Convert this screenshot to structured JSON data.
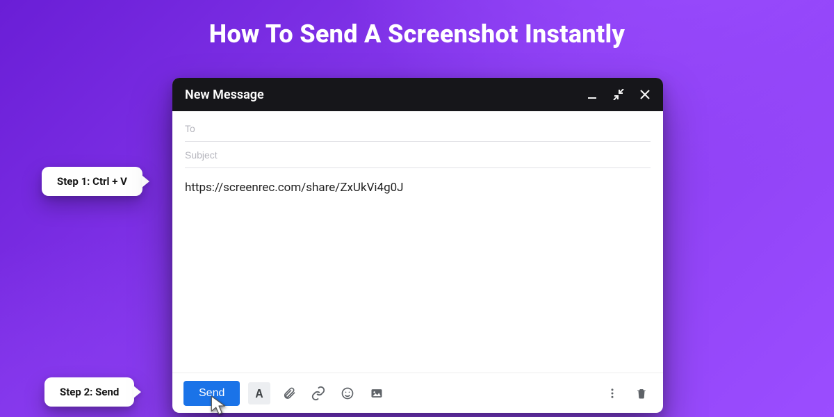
{
  "page_title": "How To Send A Screenshot Instantly",
  "steps": {
    "one": "Step 1: Ctrl + V",
    "two": "Step 2: Send"
  },
  "compose": {
    "title": "New Message",
    "to_placeholder": "To",
    "subject_placeholder": "Subject",
    "body_text": "https://screenrec.com/share/ZxUkVi4g0J",
    "send_label": "Send"
  },
  "colors": {
    "accent": "#1a73e8",
    "titlebar": "#16161a",
    "bg_primary": "#7a2de8"
  }
}
